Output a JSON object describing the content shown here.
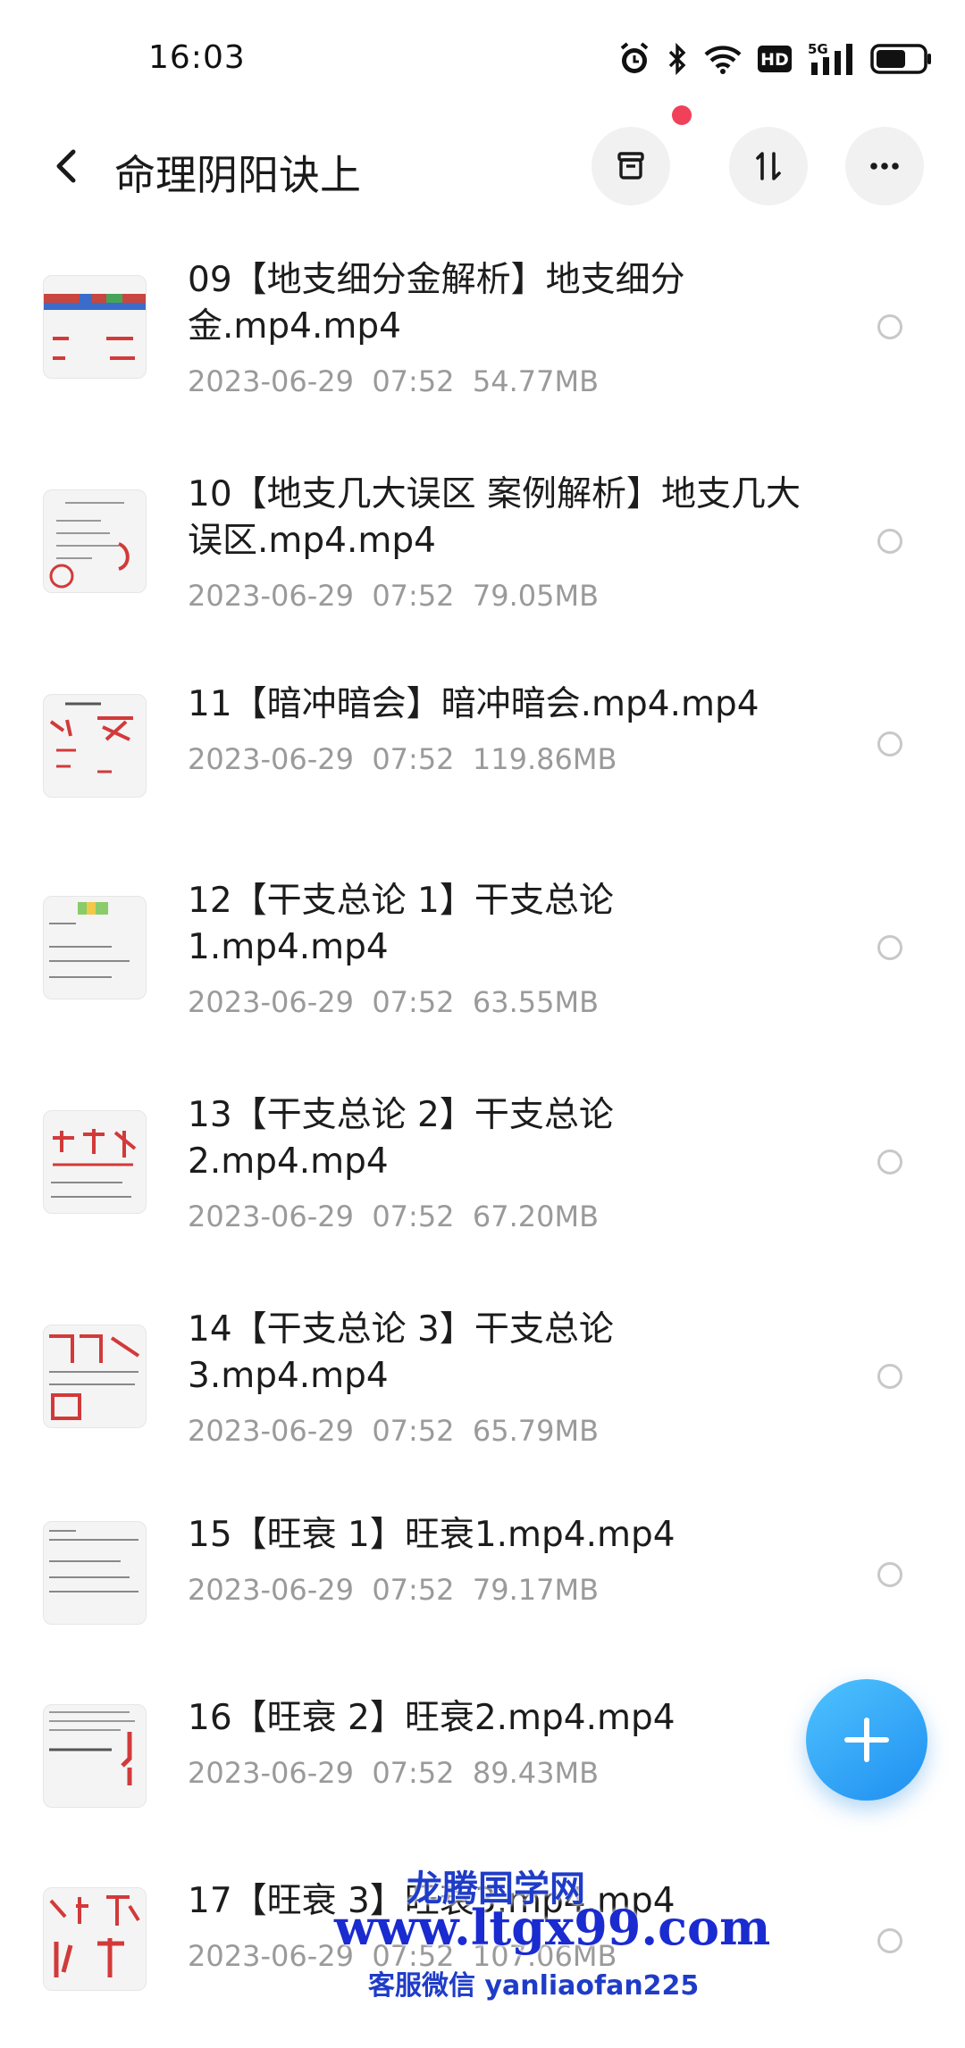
{
  "status_bar": {
    "time": "16:03",
    "icons": [
      "alarm-icon",
      "bluetooth-icon",
      "wifi-icon",
      "hd-icon",
      "5g-signal-icon",
      "battery-icon"
    ],
    "hd_label": "HD",
    "network_label": "5G"
  },
  "header": {
    "title": "命理阴阳诀上",
    "buttons": [
      "archive-icon",
      "sort-icon",
      "more-icon"
    ],
    "notification_dot_color": "#f0405a"
  },
  "files": [
    {
      "name": "09【地支细分金解析】地支细分金.mp4.mp4",
      "date": "2023-06-29",
      "time": "07:52",
      "size": "54.77MB"
    },
    {
      "name": "10【地支几大误区 案例解析】地支几大误区.mp4.mp4",
      "date": "2023-06-29",
      "time": "07:52",
      "size": "79.05MB"
    },
    {
      "name": "11【暗冲暗会】暗冲暗会.mp4.mp4",
      "date": "2023-06-29",
      "time": "07:52",
      "size": "119.86MB"
    },
    {
      "name": "12【干支总论 1】干支总论1.mp4.mp4",
      "date": "2023-06-29",
      "time": "07:52",
      "size": "63.55MB"
    },
    {
      "name": "13【干支总论 2】干支总论2.mp4.mp4",
      "date": "2023-06-29",
      "time": "07:52",
      "size": "67.20MB"
    },
    {
      "name": "14【干支总论 3】干支总论3.mp4.mp4",
      "date": "2023-06-29",
      "time": "07:52",
      "size": "65.79MB"
    },
    {
      "name": "15【旺衰 1】旺衰1.mp4.mp4",
      "date": "2023-06-29",
      "time": "07:52",
      "size": "79.17MB"
    },
    {
      "name": "16【旺衰 2】旺衰2.mp4.mp4",
      "date": "2023-06-29",
      "time": "07:52",
      "size": "89.43MB"
    },
    {
      "name": "17【旺衰 3】旺衰3.mp4.mp4",
      "date": "2023-06-29",
      "time": "07:52",
      "size": "107.06MB"
    }
  ],
  "fab": {
    "icon": "plus-icon",
    "color": "#2a9bf5"
  },
  "watermark": {
    "line1": "龙腾国学网",
    "line2": "www.ltgx99.com",
    "line3": "客服微信 yanliaofan225"
  }
}
